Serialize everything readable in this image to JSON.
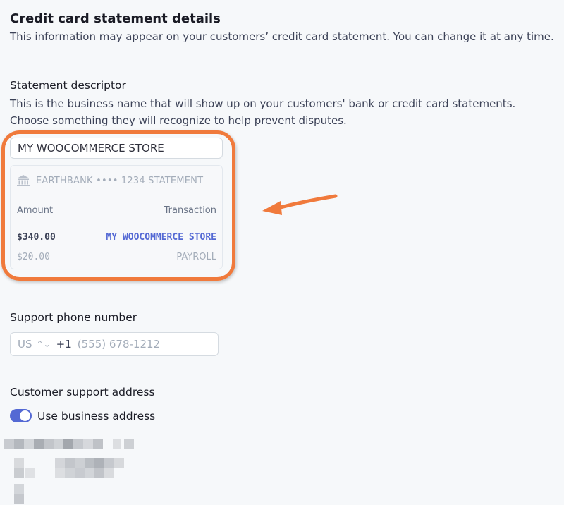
{
  "section": {
    "title": "Credit card statement details",
    "subtitle": "This information may appear on your customers’ credit card statement. You can change it at any time."
  },
  "statement_descriptor": {
    "label": "Statement descriptor",
    "help": "This is the business name that will show up on your customers' bank or credit card statements. Choose something they will recognize to help prevent disputes.",
    "value": "MY WOOCOMMERCE STORE"
  },
  "preview": {
    "bank_line": "EARTHBANK •••• 1234 STATEMENT",
    "amount_header": "Amount",
    "transaction_header": "Transaction",
    "rows": [
      {
        "amount": "$340.00",
        "transaction": "MY WOOCOMMERCE STORE"
      },
      {
        "amount": "$20.00",
        "transaction": "PAYROLL"
      }
    ]
  },
  "support_phone": {
    "label": "Support phone number",
    "country": "US",
    "dial_code": "+1",
    "placeholder": "(555) 678-1212"
  },
  "support_address": {
    "label": "Customer support address",
    "toggle_label": "Use business address",
    "toggle_on": true
  },
  "colors": {
    "accent": "#5469d4",
    "annotation": "#f07a3c"
  }
}
